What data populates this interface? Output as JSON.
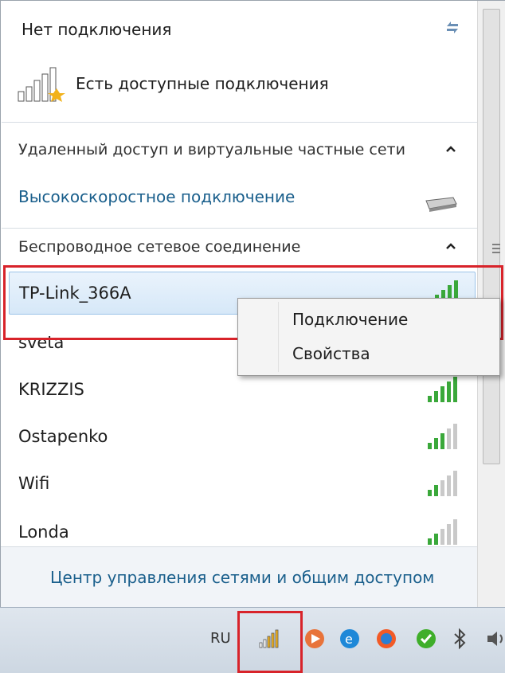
{
  "popup": {
    "status_title": "Нет подключения",
    "available_text": "Есть доступные подключения",
    "sections": [
      {
        "header": "Удаленный доступ и виртуальные частные сети",
        "expanded": true
      },
      {
        "header": "Беспроводное сетевое соединение",
        "expanded": true
      }
    ],
    "dialup_link": "Высокоскоростное подключение",
    "networks": [
      {
        "name": "TP-Link_366A",
        "selected": true,
        "signal_bars": 5
      },
      {
        "name": "sveta",
        "signal_bars": 5
      },
      {
        "name": "KRIZZIS",
        "signal_bars": 5
      },
      {
        "name": "Ostapenko",
        "signal_bars": 3
      },
      {
        "name": "Wifi",
        "signal_bars": 2
      },
      {
        "name": "Londa",
        "signal_bars": 2
      }
    ],
    "footer_link": "Центр управления сетями и общим доступом"
  },
  "context_menu": {
    "items": [
      {
        "label": "Подключение"
      },
      {
        "label": "Свойства"
      }
    ]
  },
  "taskbar": {
    "language": "RU",
    "tray_icons": [
      "network-icon",
      "media-icon",
      "internet-explorer-icon",
      "browser-icon",
      "security-check-icon",
      "bluetooth-icon",
      "speaker-icon"
    ]
  },
  "colors": {
    "link": "#1a5f8c",
    "highlight": "#d8232a",
    "signal_on": "#3aa83a",
    "signal_off": "#c9c9c9"
  }
}
